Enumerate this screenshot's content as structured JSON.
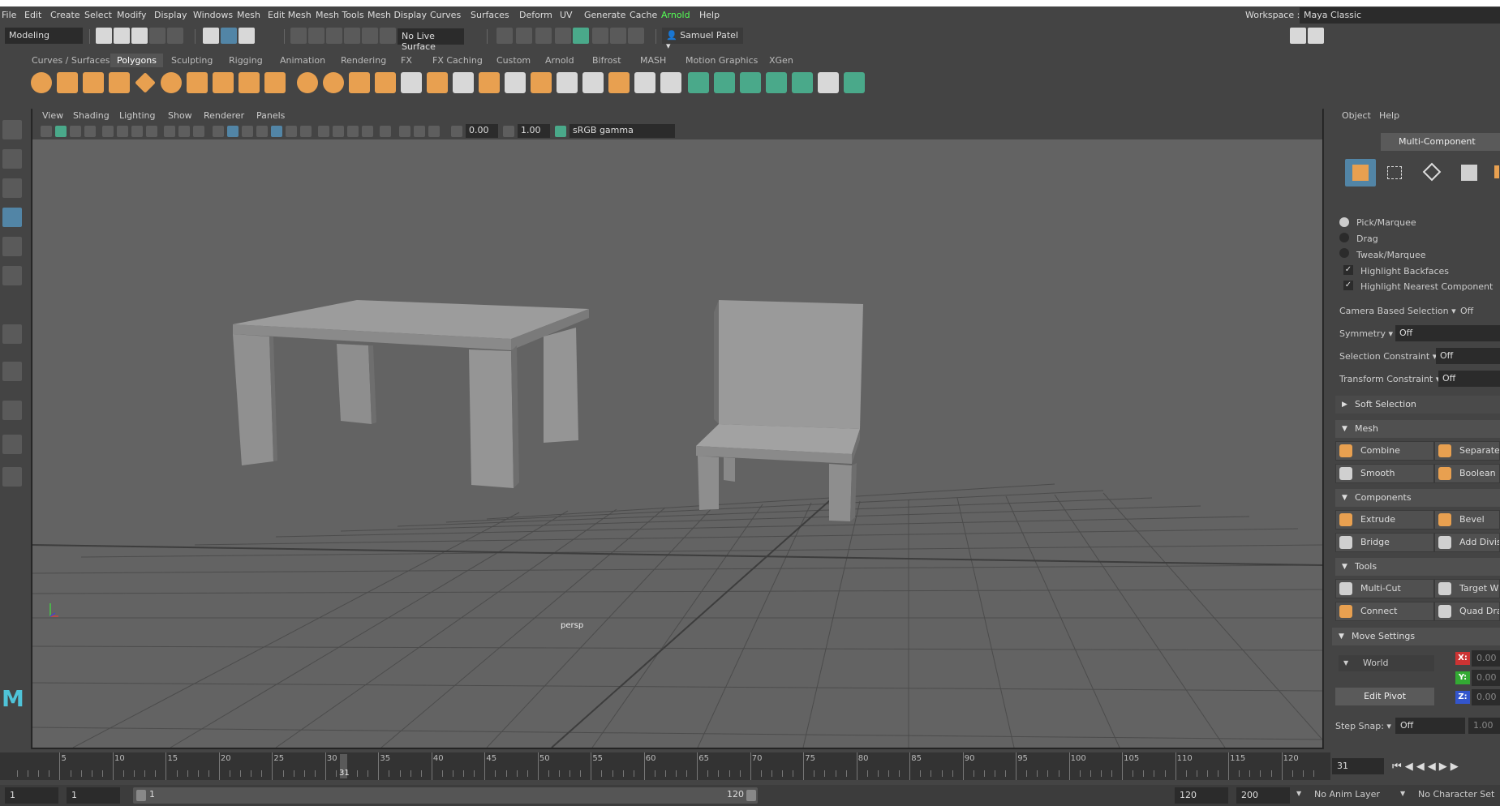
{
  "menubar": {
    "items": [
      "File",
      "Edit",
      "Create",
      "Select",
      "Modify",
      "Display",
      "Windows",
      "Mesh",
      "Edit Mesh",
      "Mesh Tools",
      "Mesh Display",
      "Curves",
      "Surfaces",
      "Deform",
      "UV",
      "Generate",
      "Cache",
      "Arnold",
      "Help"
    ],
    "workspace_label": "Workspace :",
    "workspace_value": "Maya Classic"
  },
  "statusline": {
    "mode": "Modeling",
    "live_surface": "No Live Surface",
    "user": "Samuel Patel"
  },
  "shelf_tabs": [
    "Curves / Surfaces",
    "Polygons",
    "Sculpting",
    "Rigging",
    "Animation",
    "Rendering",
    "FX",
    "FX Caching",
    "Custom",
    "Arnold",
    "Bifrost",
    "MASH",
    "Motion Graphics",
    "XGen"
  ],
  "active_shelf": "Polygons",
  "viewport": {
    "menu": [
      "View",
      "Shading",
      "Lighting",
      "Show",
      "Renderer",
      "Panels"
    ],
    "exposure": "0.00",
    "gamma": "1.00",
    "colorspace": "sRGB gamma",
    "camera_label": "persp"
  },
  "right_panel": {
    "menu": [
      "Object",
      "Help"
    ],
    "multi_component": "Multi-Component",
    "radio_options": [
      "Pick/Marquee",
      "Drag",
      "Tweak/Marquee"
    ],
    "checkbox_options": [
      "Highlight Backfaces",
      "Highlight Nearest Component"
    ],
    "camera_based_selection": {
      "label": "Camera Based Selection",
      "value": "Off"
    },
    "symmetry": {
      "label": "Symmetry",
      "value": "Off"
    },
    "selection_constraint": {
      "label": "Selection Constraint",
      "value": "Off"
    },
    "transform_constraint": {
      "label": "Transform Constraint",
      "value": "Off"
    },
    "soft_selection": "Soft Selection",
    "mesh_section": "Mesh",
    "mesh_buttons": [
      "Combine",
      "Separate",
      "Smooth",
      "Boolean"
    ],
    "components_section": "Components",
    "components_buttons": [
      "Extrude",
      "Bevel",
      "Bridge",
      "Add Divis"
    ],
    "tools_section": "Tools",
    "tools_buttons": [
      "Multi-Cut",
      "Target W",
      "Connect",
      "Quad Dra"
    ],
    "move_settings": "Move Settings",
    "world": "World",
    "edit_pivot": "Edit Pivot",
    "x_label": "X:",
    "y_label": "Y:",
    "z_label": "Z:",
    "x_val": "0.00",
    "y_val": "0.00",
    "z_val": "0.00",
    "step_snap_label": "Step Snap:",
    "step_snap_value": "Off",
    "step_snap_num": "1.00"
  },
  "timeline": {
    "ticks": [
      "5",
      "10",
      "15",
      "20",
      "25",
      "30",
      "35",
      "40",
      "45",
      "50",
      "55",
      "60",
      "65",
      "70",
      "75",
      "80",
      "85",
      "90",
      "95",
      "100",
      "105",
      "110",
      "115",
      "120"
    ],
    "current_frame": "31",
    "current_frame_field": "31"
  },
  "range": {
    "start": "1",
    "playback_start": "1",
    "slider_start": "1",
    "slider_end": "120",
    "playback_end": "120",
    "end": "200",
    "anim_layer": "No Anim Layer",
    "character_set": "No Character Set"
  },
  "colors": {
    "accent_blue": "#5285a6",
    "shelf_orange": "#e8a050",
    "highlight_green": "#55ff55"
  }
}
